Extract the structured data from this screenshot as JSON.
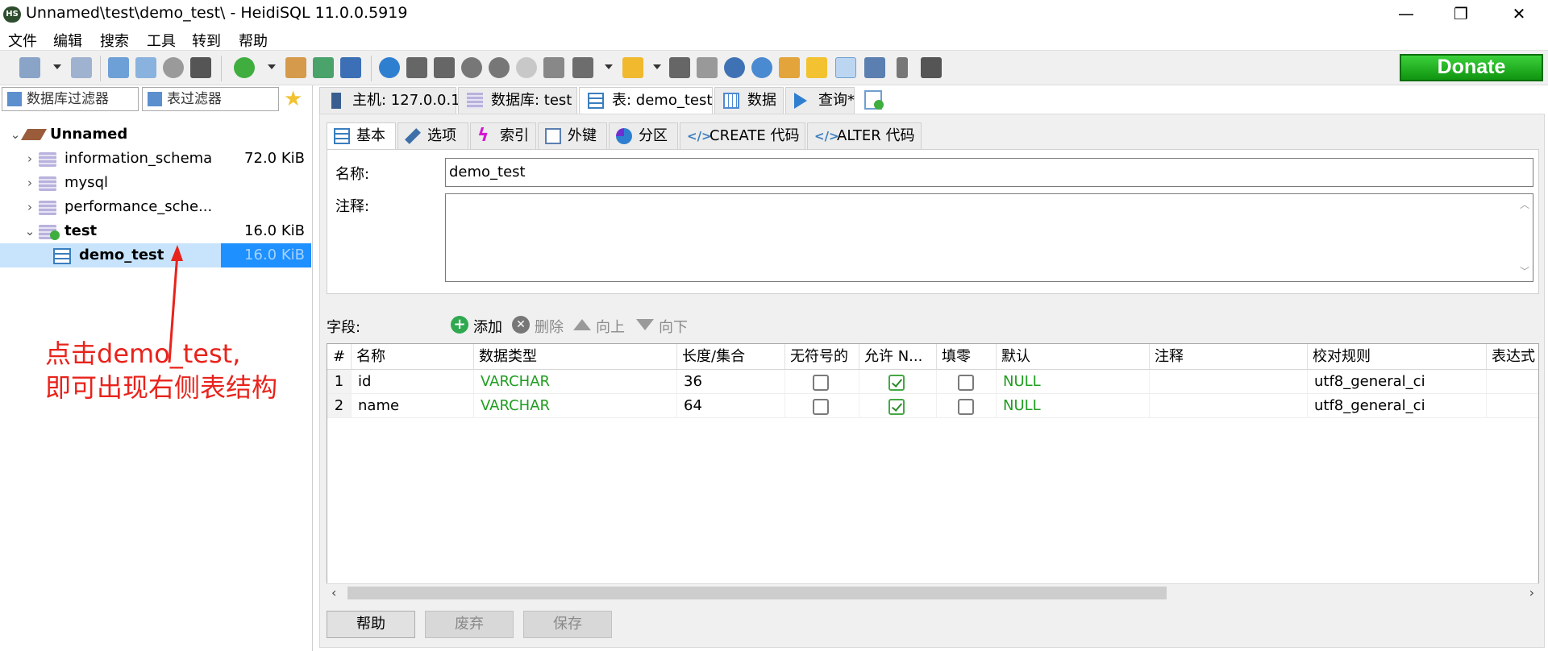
{
  "window": {
    "title": "Unnamed\\test\\demo_test\\ - HeidiSQL 11.0.0.5919",
    "app_icon": "HS",
    "minimize": "—",
    "maximize": "❐",
    "close": "✕"
  },
  "menu": [
    "文件",
    "编辑",
    "搜索",
    "工具",
    "转到",
    "帮助"
  ],
  "toolbar": {
    "donate_label": "Donate"
  },
  "filters": {
    "database_filter": "数据库过滤器",
    "table_filter": "表过滤器"
  },
  "tree": {
    "root": "Unnamed",
    "databases": [
      {
        "name": "information_schema",
        "size": "72.0 KiB"
      },
      {
        "name": "mysql",
        "size": ""
      },
      {
        "name": "performance_sche...",
        "size": ""
      },
      {
        "name": "test",
        "size": "16.0 KiB"
      }
    ],
    "selected_table": {
      "name": "demo_test",
      "size": "16.0 KiB"
    }
  },
  "annotation": {
    "line1": "点击demo_test,",
    "line2": "即可出现右侧表结构"
  },
  "tabs": [
    {
      "label": "主机: 127.0.0.1"
    },
    {
      "label": "数据库: test"
    },
    {
      "label": "表: demo_test"
    },
    {
      "label": "数据"
    },
    {
      "label": "查询*"
    }
  ],
  "subtabs": [
    {
      "label": "基本"
    },
    {
      "label": "选项"
    },
    {
      "label": "索引"
    },
    {
      "label": "外键"
    },
    {
      "label": "分区"
    },
    {
      "label": "CREATE 代码"
    },
    {
      "label": "ALTER 代码"
    }
  ],
  "basic": {
    "name_label": "名称:",
    "name_value": "demo_test",
    "comment_label": "注释:"
  },
  "fields": {
    "label": "字段:",
    "add": "添加",
    "delete": "删除",
    "up": "向上",
    "down": "向下"
  },
  "grid": {
    "headers": [
      "#",
      "名称",
      "数据类型",
      "长度/集合",
      "无符号的",
      "允许 N...",
      "填零",
      "默认",
      "注释",
      "校对规则",
      "表达式"
    ],
    "rows": [
      {
        "num": "1",
        "name": "id",
        "type": "VARCHAR",
        "length": "36",
        "unsigned": false,
        "allow_null": true,
        "zerofill": false,
        "default": "NULL",
        "comment": "",
        "collation": "utf8_general_ci"
      },
      {
        "num": "2",
        "name": "name",
        "type": "VARCHAR",
        "length": "64",
        "unsigned": false,
        "allow_null": true,
        "zerofill": false,
        "default": "NULL",
        "comment": "",
        "collation": "utf8_general_ci"
      }
    ]
  },
  "buttons": {
    "help": "帮助",
    "discard": "废弃",
    "save": "保存"
  }
}
